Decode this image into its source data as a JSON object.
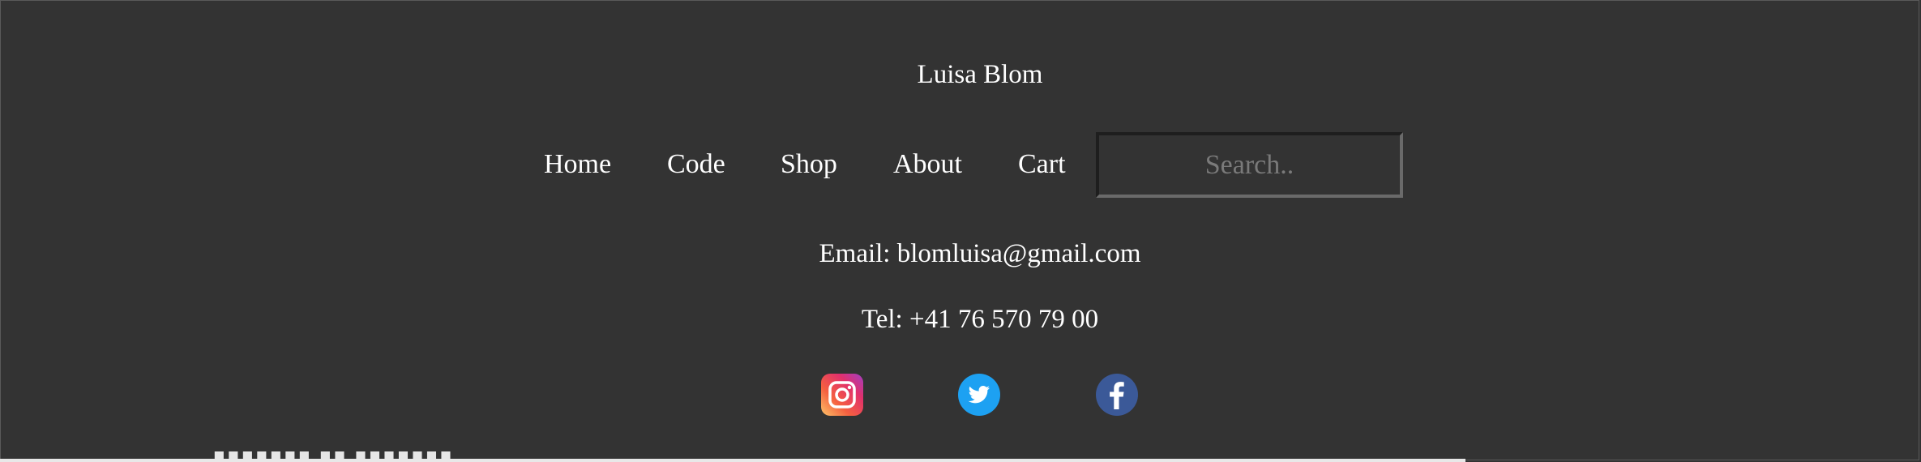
{
  "header": {
    "brand": "Luisa Blom"
  },
  "nav": {
    "items": [
      {
        "label": "Home"
      },
      {
        "label": "Code"
      },
      {
        "label": "Shop"
      },
      {
        "label": "About"
      },
      {
        "label": "Cart"
      }
    ],
    "search": {
      "placeholder": "Search..",
      "value": ""
    }
  },
  "contact": {
    "email": "Email: blomluisa@gmail.com",
    "tel": "Tel: +41 76 570 79 00"
  },
  "social": {
    "icons": [
      "instagram-icon",
      "twitter-icon",
      "facebook-icon"
    ]
  },
  "colors": {
    "background": "#333333",
    "text": "#ffffff",
    "placeholder": "#7a7a7a",
    "twitter": "#1da1f2",
    "facebook": "#3b5998"
  }
}
